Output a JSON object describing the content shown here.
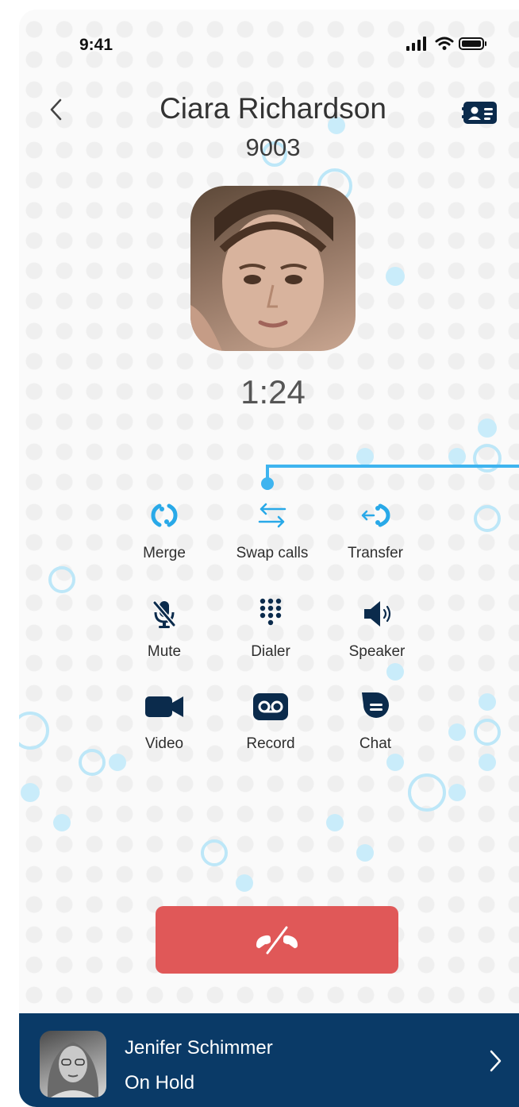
{
  "status_bar": {
    "time": "9:41"
  },
  "call": {
    "name": "Ciara Richardson",
    "number": "9003",
    "duration": "1:24"
  },
  "controls": {
    "merge": "Merge",
    "swap": "Swap calls",
    "transfer": "Transfer",
    "mute": "Mute",
    "dialer": "Dialer",
    "speaker": "Speaker",
    "video": "Video",
    "record": "Record",
    "chat": "Chat"
  },
  "on_hold": {
    "name": "Jenifer Schimmer",
    "status": "On Hold"
  },
  "icons": {
    "back": "chevron-left-icon",
    "contact_card": "contact-card-icon",
    "merge": "merge-icon",
    "swap": "swap-arrows-icon",
    "transfer": "transfer-icon",
    "mute": "mic-off-icon",
    "dialer": "keypad-icon",
    "speaker": "speaker-icon",
    "video": "video-camera-icon",
    "record": "voicemail-icon",
    "chat": "chat-bubble-icon",
    "end_call": "hang-up-icon",
    "hold_open": "chevron-right-icon"
  },
  "colors": {
    "accent": "#29a9e8",
    "icon_dark": "#0b2b4c",
    "end_call": "#e05858",
    "hold_bar": "#0a3a67"
  }
}
